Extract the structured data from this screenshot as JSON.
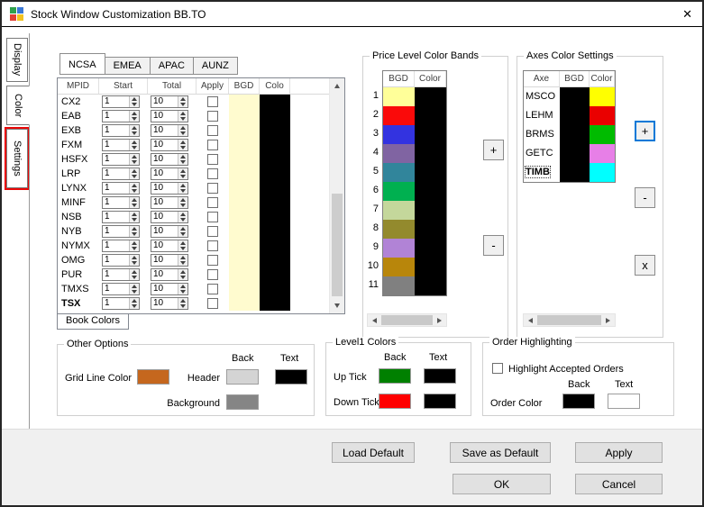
{
  "window": {
    "title": "Stock Window Customization BB.TO",
    "close_glyph": "✕"
  },
  "side_tabs": [
    {
      "label": "Display",
      "selected": false,
      "highlighted": false
    },
    {
      "label": "Color",
      "selected": true,
      "highlighted": false
    },
    {
      "label": "Settings",
      "selected": false,
      "highlighted": true
    }
  ],
  "market_tabs": [
    {
      "label": "NCSA",
      "selected": true
    },
    {
      "label": "EMEA",
      "selected": false
    },
    {
      "label": "APAC",
      "selected": false
    },
    {
      "label": "AUNZ",
      "selected": false
    }
  ],
  "mpid_table": {
    "headers": [
      "MPID",
      "Start",
      "Total",
      "Apply",
      "BGD",
      "Colo"
    ],
    "bgd_color": "#fffbcf",
    "swatch_color": "#000000",
    "footer_tab": "Book Colors",
    "rows": [
      {
        "mpid": "CX2",
        "start": "1",
        "total": "10",
        "apply": false,
        "bold": false
      },
      {
        "mpid": "EAB",
        "start": "1",
        "total": "10",
        "apply": false,
        "bold": false
      },
      {
        "mpid": "EXB",
        "start": "1",
        "total": "10",
        "apply": false,
        "bold": false
      },
      {
        "mpid": "FXM",
        "start": "1",
        "total": "10",
        "apply": false,
        "bold": false
      },
      {
        "mpid": "HSFX",
        "start": "1",
        "total": "10",
        "apply": false,
        "bold": false
      },
      {
        "mpid": "LRP",
        "start": "1",
        "total": "10",
        "apply": false,
        "bold": false
      },
      {
        "mpid": "LYNX",
        "start": "1",
        "total": "10",
        "apply": false,
        "bold": false
      },
      {
        "mpid": "MINF",
        "start": "1",
        "total": "10",
        "apply": false,
        "bold": false
      },
      {
        "mpid": "NSB",
        "start": "1",
        "total": "10",
        "apply": false,
        "bold": false
      },
      {
        "mpid": "NYB",
        "start": "1",
        "total": "10",
        "apply": false,
        "bold": false
      },
      {
        "mpid": "NYMX",
        "start": "1",
        "total": "10",
        "apply": false,
        "bold": false
      },
      {
        "mpid": "OMG",
        "start": "1",
        "total": "10",
        "apply": false,
        "bold": false
      },
      {
        "mpid": "PUR",
        "start": "1",
        "total": "10",
        "apply": false,
        "bold": false
      },
      {
        "mpid": "TMXS",
        "start": "1",
        "total": "10",
        "apply": false,
        "bold": false
      },
      {
        "mpid": "TSX",
        "start": "1",
        "total": "10",
        "apply": false,
        "bold": true
      }
    ]
  },
  "price_bands": {
    "title": "Price Level Color Bands",
    "headers": [
      "BGD",
      "Color"
    ],
    "fg_color": "#000000",
    "add_label": "+",
    "remove_label": "-",
    "rows": [
      {
        "num": "1",
        "bgd": "#ffff99"
      },
      {
        "num": "2",
        "bgd": "#fa0a0a"
      },
      {
        "num": "3",
        "bgd": "#3333e0"
      },
      {
        "num": "4",
        "bgd": "#8064a2"
      },
      {
        "num": "5",
        "bgd": "#31859b"
      },
      {
        "num": "6",
        "bgd": "#00b050"
      },
      {
        "num": "7",
        "bgd": "#c4d79b"
      },
      {
        "num": "8",
        "bgd": "#938a2d"
      },
      {
        "num": "9",
        "bgd": "#b183d6"
      },
      {
        "num": "10",
        "bgd": "#b8860b"
      },
      {
        "num": "11",
        "bgd": "#808080"
      }
    ]
  },
  "axes_settings": {
    "title": "Axes Color Settings",
    "headers": [
      "Axe",
      "BGD",
      "Color"
    ],
    "bgd_color": "#000000",
    "add_label": "+",
    "remove_label": "-",
    "delete_label": "x",
    "rows": [
      {
        "axe": "MSCO",
        "color": "#ffff00",
        "selected": false
      },
      {
        "axe": "LEHM",
        "color": "#ea0000",
        "selected": false
      },
      {
        "axe": "BRMS",
        "color": "#00bb00",
        "selected": false
      },
      {
        "axe": "GETC",
        "color": "#e77fe7",
        "selected": false
      },
      {
        "axe": "TIMB",
        "color": "#00ffff",
        "selected": true
      }
    ]
  },
  "other_options": {
    "title": "Other Options",
    "back_header": "Back",
    "text_header": "Text",
    "grid_line_label": "Grid Line Color",
    "grid_line_color": "#c5671e",
    "header_label": "Header",
    "header_back_color": "#d4d4d4",
    "header_text_color": "#000000",
    "background_label": "Background",
    "background_color": "#858585"
  },
  "level1_colors": {
    "title": "Level1 Colors",
    "back_header": "Back",
    "text_header": "Text",
    "up_label": "Up Tick",
    "up_back": "#008000",
    "up_text": "#000000",
    "down_label": "Down Tick",
    "down_back": "#ff0000",
    "down_text": "#000000"
  },
  "order_highlighting": {
    "title": "Order Highlighting",
    "checkbox_label": "Highlight Accepted Orders",
    "checked": false,
    "back_header": "Back",
    "text_header": "Text",
    "order_color_label": "Order Color",
    "order_back": "#000000",
    "order_text": "#ffffff"
  },
  "footer_buttons": {
    "load_default": "Load Default",
    "save_as_default": "Save as Default",
    "apply": "Apply",
    "ok": "OK",
    "cancel": "Cancel"
  }
}
